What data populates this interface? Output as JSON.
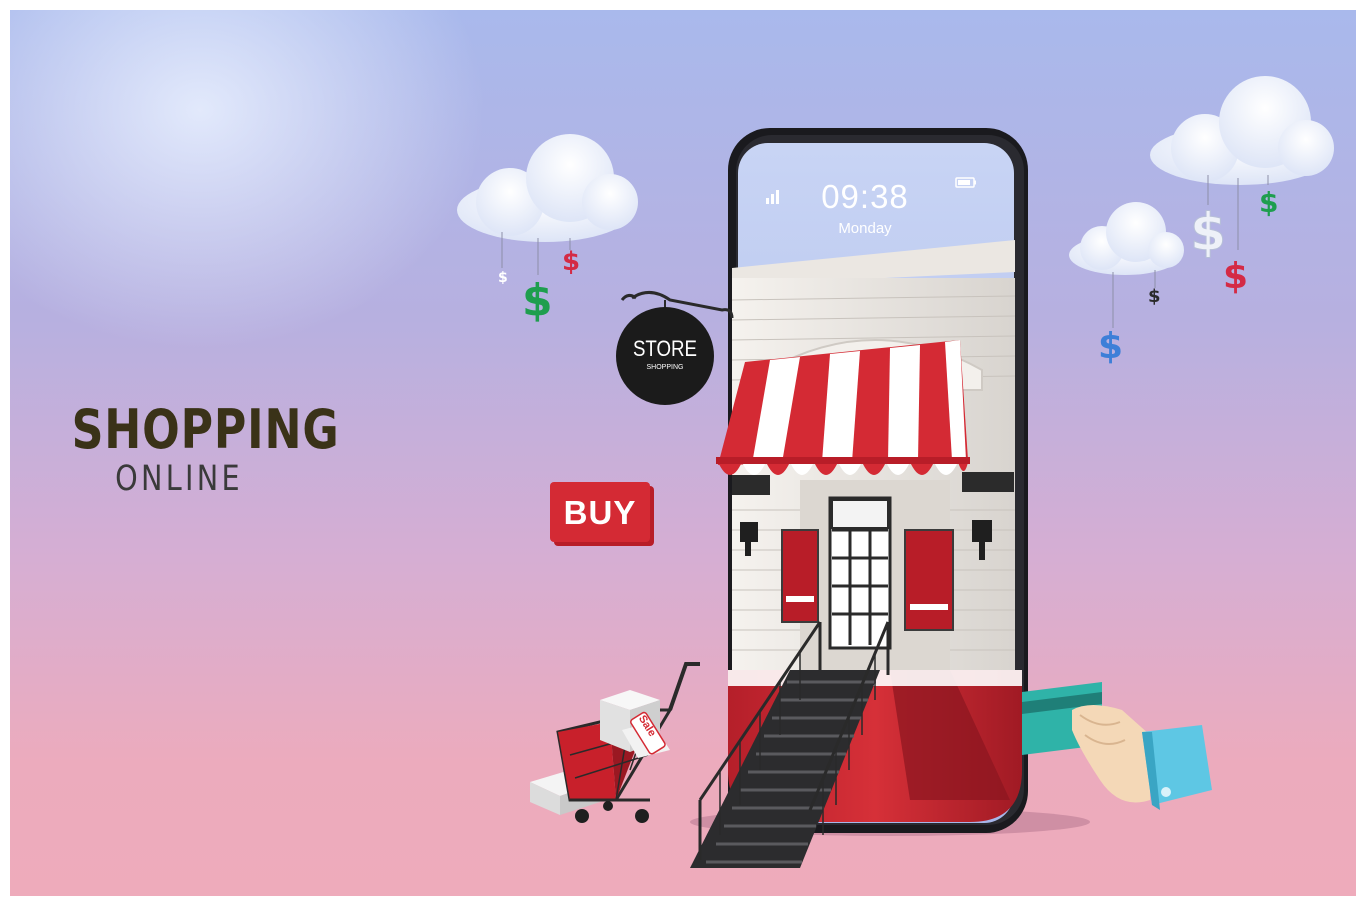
{
  "headline": {
    "line1": "SHOPPING",
    "line2": "ONLINE"
  },
  "phone": {
    "time": "09:38",
    "day": "Monday"
  },
  "store_sign": {
    "title": "STORE",
    "subtitle": "SHOPPING"
  },
  "buy_sign": "BUY",
  "cart_tag": "Sale",
  "dollar_symbol": "$",
  "colors": {
    "awning_red": "#d42a34",
    "sign_black": "#1b1b1b",
    "dollar_green": "#1e9e4e",
    "dollar_red": "#d42a45",
    "dollar_blue": "#3d7fd8",
    "card_teal": "#2fb3a8"
  }
}
